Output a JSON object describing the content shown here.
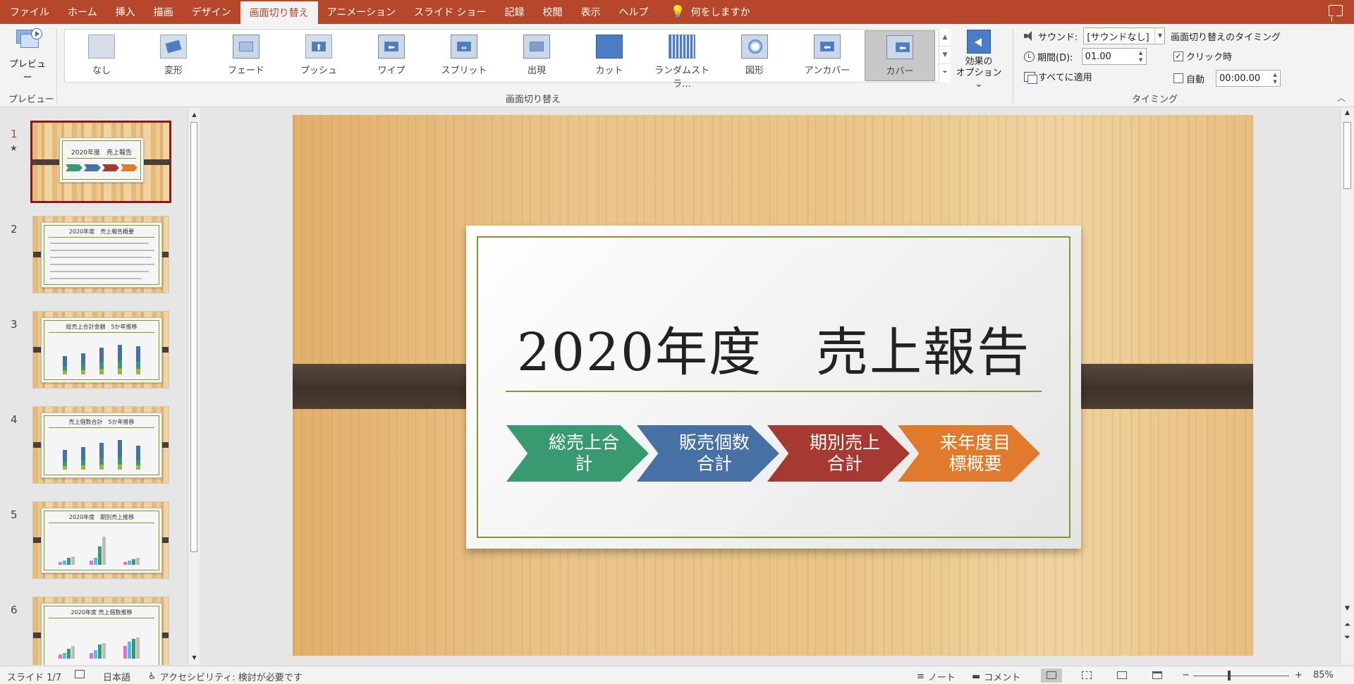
{
  "menu": {
    "tabs": [
      "ファイル",
      "ホーム",
      "挿入",
      "描画",
      "デザイン",
      "画面切り替え",
      "アニメーション",
      "スライド ショー",
      "記録",
      "校閲",
      "表示",
      "ヘルプ"
    ],
    "active_tab": "画面切り替え",
    "tell_me": "何をしますか"
  },
  "ribbon": {
    "preview": {
      "button_label": "プレビュー",
      "group_label": "プレビュー"
    },
    "transitions": {
      "group_label": "画面切り替え",
      "items": [
        "なし",
        "変形",
        "フェード",
        "プッシュ",
        "ワイプ",
        "スプリット",
        "出現",
        "カット",
        "ランダムストラ…",
        "図形",
        "アンカバー",
        "カバー"
      ],
      "selected": "カバー",
      "effect_options_label_1": "効果の",
      "effect_options_label_2": "オプション ⌄"
    },
    "timing": {
      "group_label": "タイミング",
      "sound_label": "サウンド:",
      "sound_value": "[サウンドなし]",
      "duration_label": "期間(D):",
      "duration_value": "01.00",
      "apply_all_label": "すべてに適用",
      "advance_heading": "画面切り替えのタイミング",
      "on_click_label": "クリック時",
      "on_click_checked": true,
      "auto_label": "自動",
      "auto_checked": false,
      "auto_value": "00:00.00"
    }
  },
  "thumbnails": [
    {
      "number": "1",
      "title": "2020年度　売上報告",
      "has_animation_star": true
    },
    {
      "number": "2",
      "title": "2020年度　売上報告概要"
    },
    {
      "number": "3",
      "title": "総売上合計金額　5か年推移"
    },
    {
      "number": "4",
      "title": "売上個数合計　5か年推移"
    },
    {
      "number": "5",
      "title": "2020年度　期別売上推移"
    },
    {
      "number": "6",
      "title": "2020年度 売上個数推移"
    }
  ],
  "slide": {
    "title": "2020年度　売上報告",
    "chevrons": [
      {
        "text": "総売上合計",
        "color": "#3a9a6f"
      },
      {
        "text": "販売個数合計",
        "color": "#4770a5"
      },
      {
        "text": "期別売上合計",
        "color": "#a63a32"
      },
      {
        "text": "来年度目標概要",
        "color": "#e07a2c"
      }
    ],
    "accent_color": "#7e9a2c"
  },
  "status": {
    "slide_counter": "スライド 1/7",
    "language": "日本語",
    "accessibility": "アクセシビリティ: 検討が必要です",
    "notes_label": "ノート",
    "comments_label": "コメント",
    "zoom": "85%",
    "zoom_minus": "−",
    "zoom_plus": "+"
  },
  "colors": {
    "brand": "#b7472a",
    "ribbon_bg": "#f3f3f3"
  }
}
